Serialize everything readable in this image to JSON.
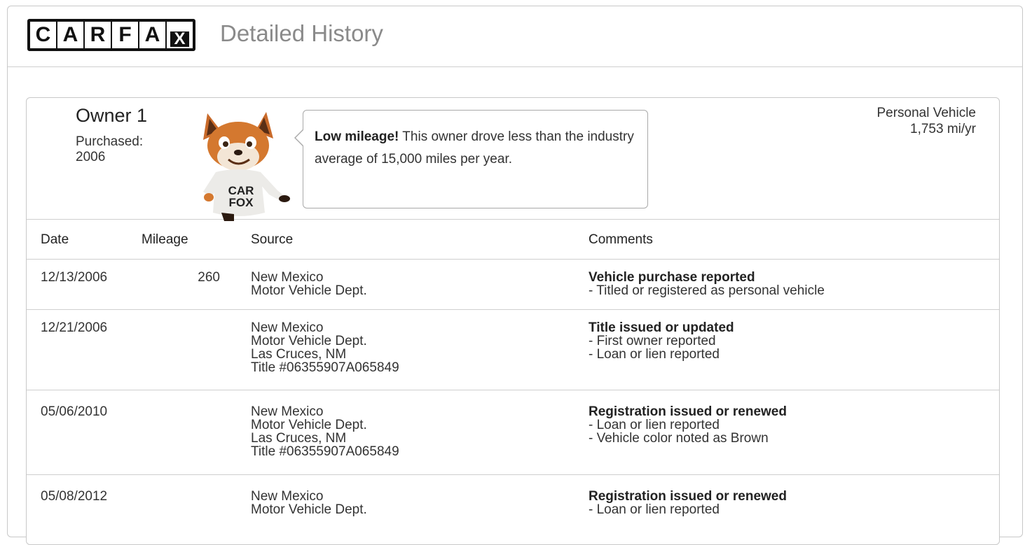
{
  "header": {
    "logo_letters": [
      "C",
      "A",
      "R",
      "F",
      "A",
      "X"
    ],
    "title": "Detailed History"
  },
  "owner": {
    "name": "Owner 1",
    "purchased_label": "Purchased:",
    "purchased_year": "2006",
    "mascot_shirt_text": [
      "CAR",
      "FOX"
    ],
    "bubble": {
      "bold": "Low mileage!",
      "text": " This owner drove less than the industry average of 15,000 miles per year."
    },
    "vehicle_type": "Personal Vehicle",
    "mileage_per_year": "1,753 mi/yr"
  },
  "table": {
    "columns": [
      "Date",
      "Mileage",
      "Source",
      "Comments"
    ],
    "rows": [
      {
        "date": "12/13/2006",
        "mileage": "260",
        "source": [
          "New Mexico",
          "Motor Vehicle Dept."
        ],
        "comment_head": "Vehicle purchase reported",
        "comment_lines": [
          "- Titled or registered as personal vehicle"
        ]
      },
      {
        "date": "12/21/2006",
        "mileage": "",
        "source": [
          "New Mexico",
          "Motor Vehicle Dept.",
          "Las Cruces, NM",
          "Title #06355907A065849"
        ],
        "comment_head": "Title issued or updated",
        "comment_lines": [
          "- First owner reported",
          "- Loan or lien reported"
        ]
      },
      {
        "date": "05/06/2010",
        "mileage": "",
        "source": [
          "New Mexico",
          "Motor Vehicle Dept.",
          "Las Cruces, NM",
          "Title #06355907A065849"
        ],
        "comment_head": "Registration issued or renewed",
        "comment_lines": [
          "- Loan or lien reported",
          "- Vehicle color noted as Brown"
        ]
      },
      {
        "date": "05/08/2012",
        "mileage": "",
        "source": [
          "New Mexico",
          "Motor Vehicle Dept."
        ],
        "comment_head": "Registration issued or renewed",
        "comment_lines": [
          "- Loan or lien reported"
        ]
      }
    ]
  }
}
